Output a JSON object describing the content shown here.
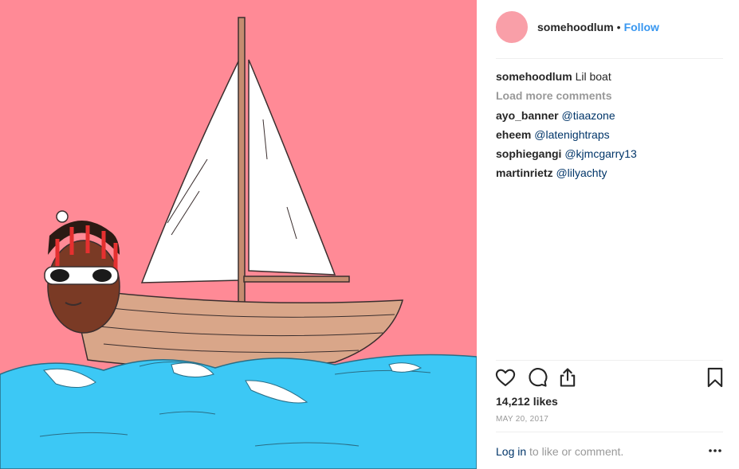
{
  "post": {
    "username": "somehoodlum",
    "separator": "•",
    "follow_label": "Follow",
    "caption_user": "somehoodlum",
    "caption_text": "Lil boat",
    "load_more": "Load more comments",
    "comments": [
      {
        "user": "ayo_banner",
        "mention": "@tiaazone"
      },
      {
        "user": "eheem",
        "mention": "@latenightraps"
      },
      {
        "user": "sophiegangi",
        "mention": "@kjmcgarry13"
      },
      {
        "user": "martinrietz",
        "mention": "@lilyachty"
      }
    ],
    "likes": "14,212 likes",
    "date": "MAY 20, 2017",
    "login_link": "Log in",
    "login_text": " to like or comment."
  },
  "icons": [
    "heart-icon",
    "comment-icon",
    "share-icon",
    "bookmark-icon",
    "more-options-icon"
  ],
  "colors": {
    "image_background": "#ff8a96",
    "water": "#3cc8f5",
    "boat": "#d9a689",
    "avatar": "#f99fa8",
    "follow": "#3897f0",
    "mention": "#003569"
  }
}
